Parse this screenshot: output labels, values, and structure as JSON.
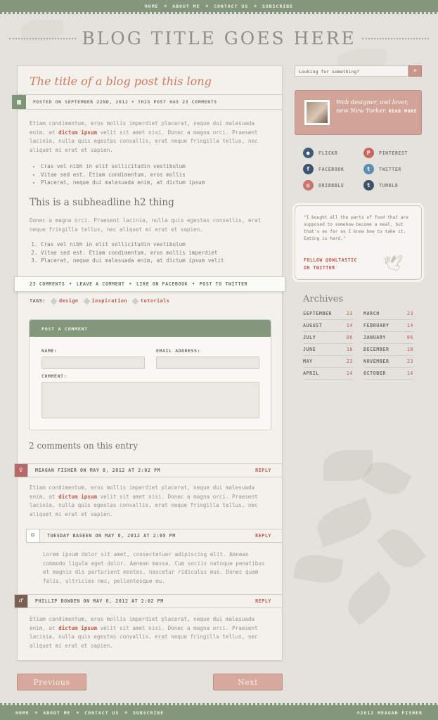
{
  "nav": {
    "items": [
      "HOME",
      "ABOUT ME",
      "CONTACT US",
      "SUBSCRIBE"
    ]
  },
  "site_title": "BLOG TITLE GOES HERE",
  "post": {
    "title": "The title of a blog post this long",
    "meta": "POSTED ON SEPTEMBER 22ND, 2012 • THIS POST HAS 23 COMMENTS",
    "p1_a": "Etiam condimentum, eros mollis imperdiet placerat, neque dui malesuada enim, at ",
    "p1_link": "dictum ipsum",
    "p1_b": " velit sit amet nisi. Donec a magna orci. Praesent lacinia, nulla quis egestas convallis, erat neque fringilla tellus, nec aliquet mi erat et sapien.",
    "bullets": [
      "Cras vel nibh in elit sollicitudin vestibulum",
      "Vitae sed est. Etiam condimentum, eros mollis",
      "Placerat, neque dui malesuada enim, at dictum ipsum"
    ],
    "h2": "This is a subheadline h2 thing",
    "p2": "Donec a magna orci. Praesent lacinia, nulla quis egestas convallis, erat neque fringilla tellus, nec aliquet mi erat et sapien.",
    "numbered": [
      "Cras vel nibh in elit sollicitudin vestibulum",
      "Vitae sed est. Etiam condimentum, eros mollis imperdiet",
      "Placerat, neque dui malesuada enim, at dictum ipsum velit"
    ],
    "actions": [
      "23 COMMENTS",
      "LEAVE A COMMENT",
      "LIKE ON FACEBOOK",
      "POST TO TWITTER"
    ],
    "tags_label": "TAGS:",
    "tags": [
      "design",
      "inspiration",
      "tutorials"
    ]
  },
  "form": {
    "title": "POST A COMMENT",
    "name_label": "NAME:",
    "email_label": "EMAIL ADDRESS:",
    "comment_label": "COMMENT:"
  },
  "comments": {
    "heading": "2 comments on this entry",
    "reply_label": "REPLY",
    "c1_meta": "MEAGAN FISHER ON MAY 8, 2012 AT 2:02 PM",
    "c1_a": "Etiam condimentum, eros mollis imperdiet placerat, neque dui malesuada enim, at ",
    "c1_link": "dictum ipsum",
    "c1_b": " velit sit amet nisi. Donec a magna orci. Praesent lacinia, nulla quis egestas convallis, erat neque fringilla tellus, nec aliquet mi erat et sapien.",
    "c2_meta": "TUESDAY BASEEN ON MAY 8, 2012 AT 2:05 PM",
    "c2_text": "Lorem ipsum dolor sit amet, consectetuer adipiscing elit. Aenean commodo ligula eget dolor. Aenean massa. Cum sociis natoque penatibus et magnis dis parturient montes, nascetur ridiculus mus. Donec quam felis, ultricies nec, pellentesque eu.",
    "c3_meta": "PHILLIP BOWDEN ON MAY 8, 2012 AT 2:02 PM",
    "c3_a": "Etiam condimentum, eros mollis imperdiet placerat, neque dui malesuada enim, at ",
    "c3_link": "dictum ipsum",
    "c3_b": " velit sit amet nisi. Donec a magna orci. Praesent lacinia, nulla quis egestas convallis, erat neque fringilla tellus, nec aliquet mi erat et sapien."
  },
  "pager": {
    "prev": "Previous",
    "next": "Next"
  },
  "footer": {
    "items": [
      "HOME",
      "ABOUT ME",
      "CONTACT US",
      "SUBSCRIBE"
    ],
    "copyright": "©2012 MEAGAN FISHER"
  },
  "sidebar": {
    "search_placeholder": "Looking for something?",
    "bio": "Web designer, owl lover, new New Yorker.",
    "bio_more": "READ MORE",
    "social": [
      {
        "label": "FLICKR",
        "icon": "flickr-icon",
        "color": "#3f5a7a"
      },
      {
        "label": "PINTEREST",
        "icon": "pinterest-icon",
        "color": "#c9665f"
      },
      {
        "label": "FACEBOOK",
        "icon": "facebook-icon",
        "color": "#3d5470"
      },
      {
        "label": "TWITTER",
        "icon": "twitter-icon",
        "color": "#5d8fb0"
      },
      {
        "label": "DRIBBBLE",
        "icon": "dribbble-icon",
        "color": "#c9766f"
      },
      {
        "label": "TUMBLR",
        "icon": "tumblr-icon",
        "color": "#3f5266"
      }
    ],
    "quote": "\"I bought all the parts of food that are supposed to somehow become a meal, but that's as far as I know how to take it. Eating is hard.\"",
    "follow": "FOLLOW @OWLTASTIC",
    "follow2": "ON TWITTER",
    "archives_title": "Archives",
    "archives_left": [
      [
        "SEPTEMBER",
        "23"
      ],
      [
        "AUGUST",
        "14"
      ],
      [
        "JULY",
        "06"
      ],
      [
        "JUNE",
        "18"
      ],
      [
        "MAY",
        "23"
      ],
      [
        "APRIL",
        "14"
      ]
    ],
    "archives_right": [
      [
        "MARCH",
        "23"
      ],
      [
        "FEBRUARY",
        "14"
      ],
      [
        "JANUARY",
        "06"
      ],
      [
        "DECEMBER",
        "18"
      ],
      [
        "NOVEMBER",
        "23"
      ],
      [
        "OCTOBER",
        "14"
      ]
    ]
  }
}
